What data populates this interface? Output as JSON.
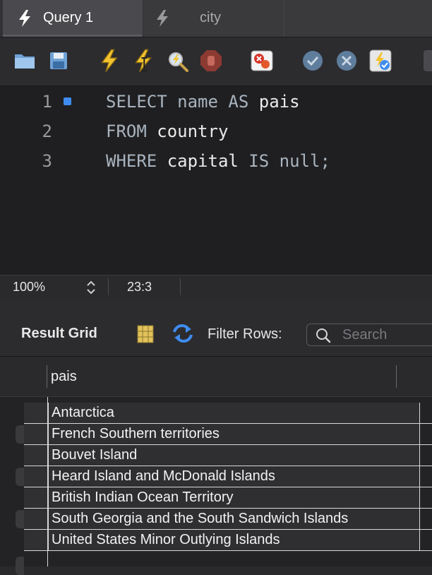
{
  "tabs": [
    {
      "label": "Query 1",
      "icon": "lightning-icon",
      "active": true
    },
    {
      "label": "city",
      "icon": "lightning-icon",
      "active": false
    }
  ],
  "toolbar": {
    "buttons": [
      {
        "name": "open-file-button",
        "icon": "folder-icon"
      },
      {
        "name": "save-button",
        "icon": "floppy-disk-icon"
      },
      {
        "name": "execute-button",
        "icon": "lightning-icon"
      },
      {
        "name": "execute-current-button",
        "icon": "lightning-cursor-icon"
      },
      {
        "name": "explain-button",
        "icon": "magnifier-lightning-icon"
      },
      {
        "name": "stop-button",
        "icon": "stop-hand-icon"
      },
      {
        "name": "toggle-error-button",
        "icon": "error-toggle-icon"
      },
      {
        "name": "commit-button",
        "icon": "check-circle-icon"
      },
      {
        "name": "rollback-button",
        "icon": "x-circle-icon"
      },
      {
        "name": "autocommit-button",
        "icon": "autocommit-icon"
      }
    ]
  },
  "editor": {
    "lines": [
      {
        "number": "1",
        "tokens": [
          {
            "t": "SELECT",
            "k": "kw"
          },
          {
            "t": " name ",
            "k": "kw"
          },
          {
            "t": "AS",
            "k": "kw"
          },
          {
            "t": " pais",
            "k": "id"
          }
        ],
        "marker": true
      },
      {
        "number": "2",
        "tokens": [
          {
            "t": "FROM",
            "k": "kw"
          },
          {
            "t": " country",
            "k": "id"
          }
        ],
        "marker": false
      },
      {
        "number": "3",
        "tokens": [
          {
            "t": "WHERE",
            "k": "kw"
          },
          {
            "t": " capital ",
            "k": "id"
          },
          {
            "t": "IS",
            "k": "kw"
          },
          {
            "t": " null;",
            "k": "kw"
          }
        ],
        "marker": false
      }
    ]
  },
  "status": {
    "zoom": "100%",
    "cursor": "23:3"
  },
  "result": {
    "title": "Result Grid",
    "filter_label": "Filter Rows:",
    "search_placeholder": "Search",
    "column": "pais",
    "rows": [
      "Antarctica",
      "French Southern territories",
      "Bouvet Island",
      "Heard Island and McDonald Islands",
      "British Indian Ocean Territory",
      "South Georgia and the South Sandwich Islands",
      "United States Minor Outlying Islands"
    ]
  },
  "colors": {
    "accent": "#3f8cf0",
    "keyword": "#a9b4bf",
    "lightning": "#f2c230"
  }
}
